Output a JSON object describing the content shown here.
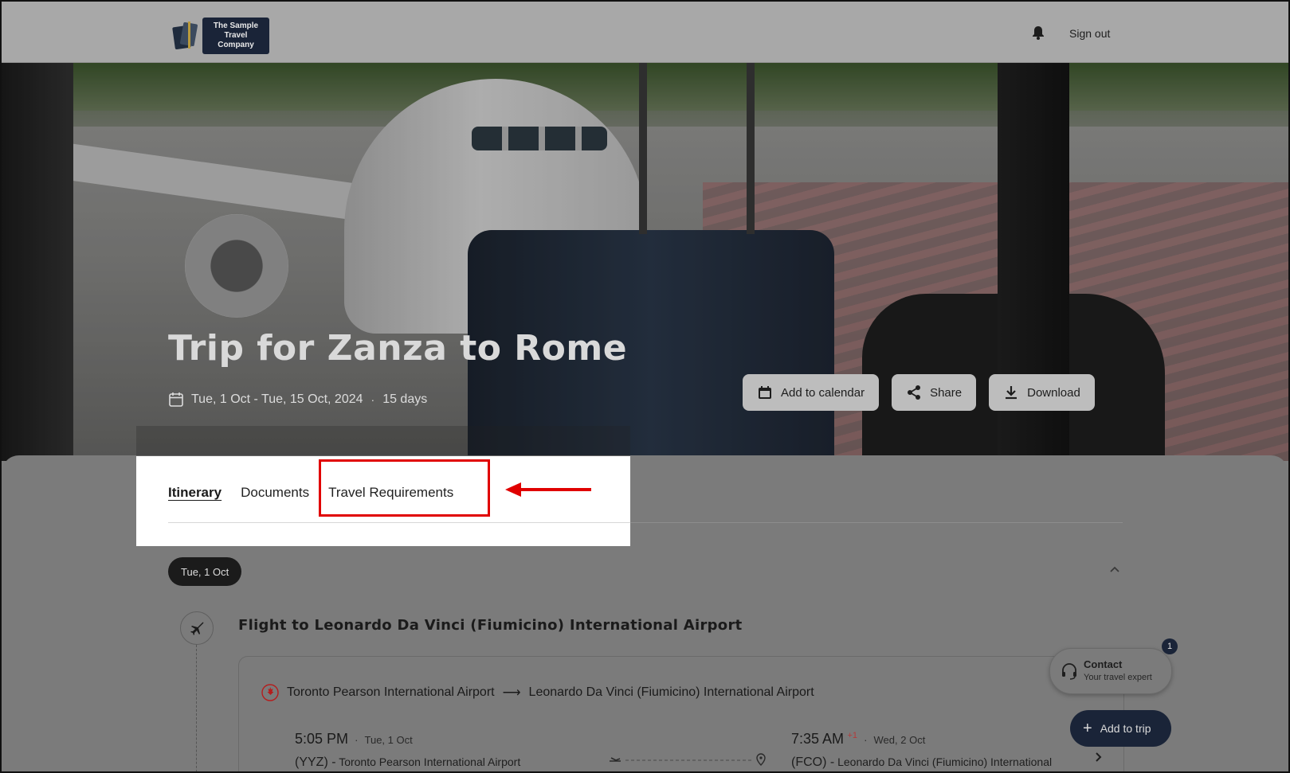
{
  "brand": {
    "name": "The Sample Travel Company"
  },
  "header": {
    "sign_out": "Sign out"
  },
  "trip": {
    "title": "Trip for Zanza to Rome",
    "dates": "Tue, 1 Oct - Tue, 15 Oct, 2024",
    "duration": "15 days"
  },
  "actions": {
    "add_to_calendar": "Add to calendar",
    "share": "Share",
    "download": "Download"
  },
  "tabs": [
    {
      "label": "Itinerary",
      "active": true
    },
    {
      "label": "Documents",
      "active": false
    },
    {
      "label": "Travel Requirements",
      "active": false
    }
  ],
  "day": {
    "date": "Tue, 1 Oct"
  },
  "flight": {
    "title": "Flight to Leonardo Da Vinci (Fiumicino) International Airport",
    "from": "Toronto Pearson International Airport",
    "to": "Leonardo Da Vinci (Fiumicino) International Airport",
    "departure": {
      "time": "5:05 PM",
      "date": "Tue, 1 Oct",
      "code": "(YYZ) -",
      "airport": "Toronto Pearson International Airport"
    },
    "arrival": {
      "time": "7:35 AM",
      "day_offset": "+1",
      "date": "Wed, 2 Oct",
      "code": "(FCO) -",
      "airport": "Leonardo Da Vinci (Fiumicino) International"
    }
  },
  "contact": {
    "title": "Contact",
    "subtitle": "Your travel expert",
    "badge": "1"
  },
  "add_to_trip": "Add to trip",
  "colors": {
    "accent": "#e00000",
    "navy": "#1a2438"
  }
}
